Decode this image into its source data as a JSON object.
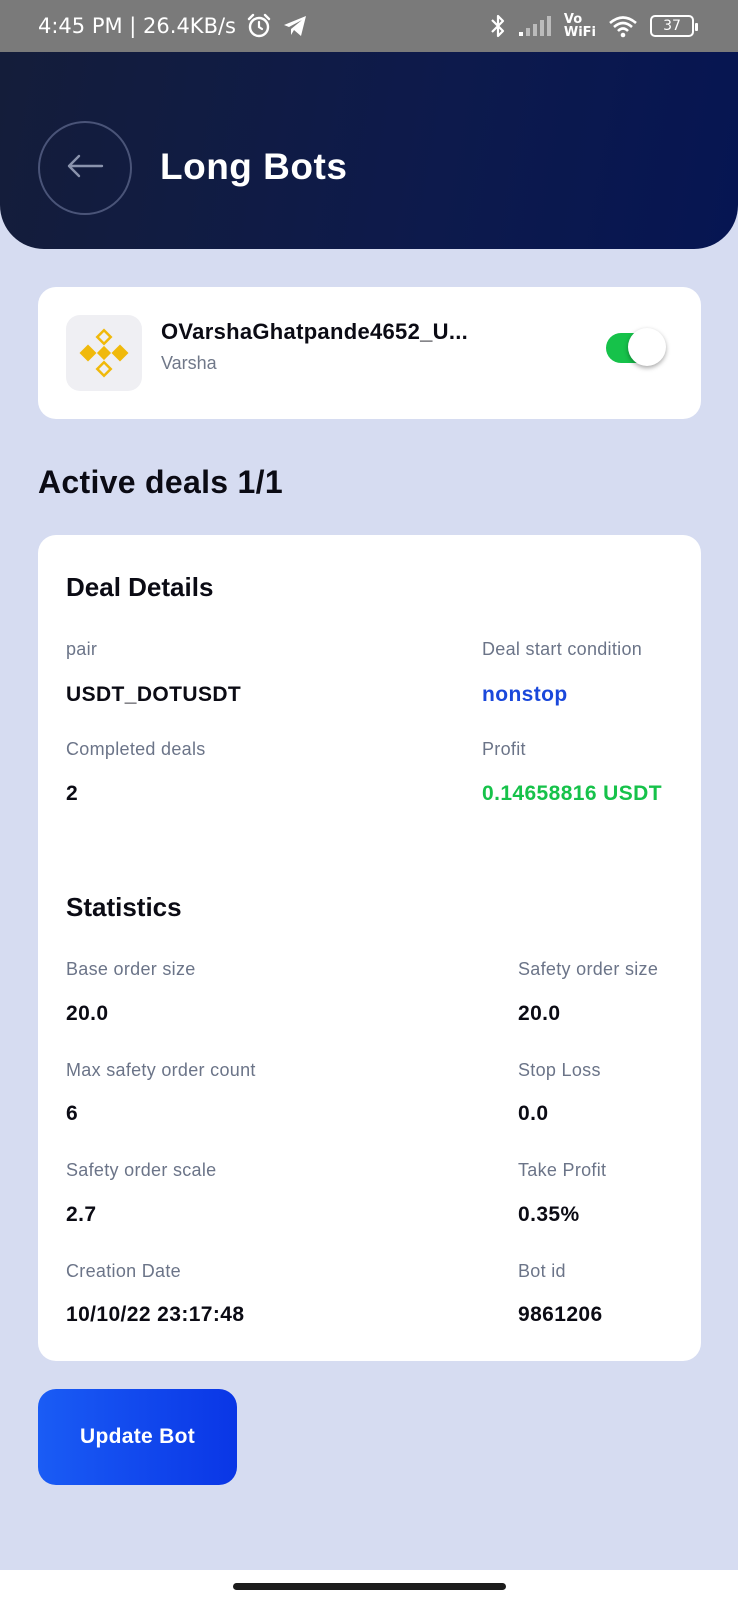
{
  "status_bar": {
    "time_speed": "4:45 PM | 26.4KB/s",
    "vo_top": "Vo",
    "vo_bottom": "WiFi",
    "battery": "37"
  },
  "header": {
    "title": "Long Bots",
    "back_icon": "arrow-left-icon"
  },
  "account": {
    "name": "OVarshaGhatpande4652_U...",
    "subtitle": "Varsha",
    "exchange_icon": "binance-logo",
    "toggle_on": true,
    "toggle_color": "#16c24a"
  },
  "active_deals": {
    "heading": "Active deals 1/1"
  },
  "deal_details": {
    "title": "Deal Details",
    "pair_label": "pair",
    "pair_value": "USDT_DOTUSDT",
    "start_condition_label": "Deal start condition",
    "start_condition_value": "nonstop",
    "completed_label": "Completed deals",
    "completed_value": "2",
    "profit_label": "Profit",
    "profit_value": "0.14658816 USDT"
  },
  "statistics": {
    "title": "Statistics",
    "base_order_label": "Base order size",
    "base_order_value": "20.0",
    "safety_order_label": "Safety order size",
    "safety_order_value": "20.0",
    "max_safety_label": "Max safety order count",
    "max_safety_value": "6",
    "stop_loss_label": "Stop Loss",
    "stop_loss_value": "0.0",
    "safety_scale_label": "Safety order scale",
    "safety_scale_value": "2.7",
    "take_profit_label": "Take Profit",
    "take_profit_value": "0.35%",
    "creation_label": "Creation Date",
    "creation_value": "10/10/22 23:17:48",
    "bot_id_label": "Bot id",
    "bot_id_value": "9861206"
  },
  "actions": {
    "update_label": "Update Bot"
  },
  "colors": {
    "background": "#d6dcf1",
    "header": "#0d1a4c",
    "accent_blue": "#1a48db",
    "profit_green": "#16c24a",
    "button_blue": "#0a36e6"
  }
}
